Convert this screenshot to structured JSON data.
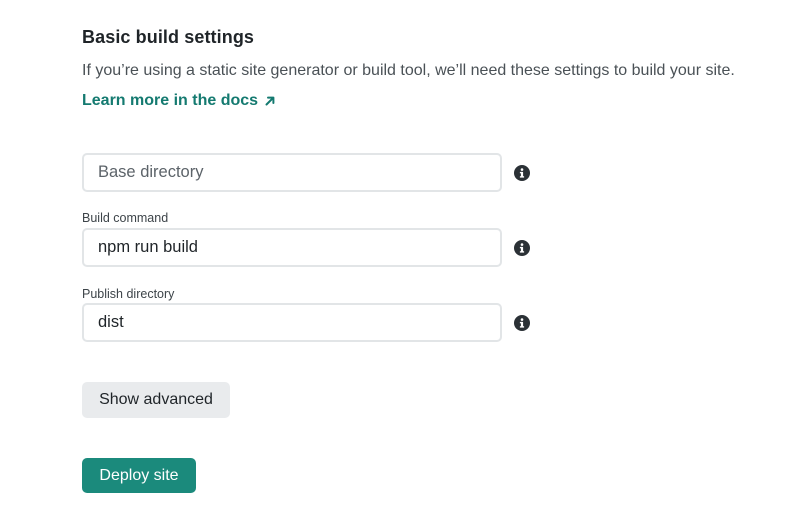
{
  "section": {
    "title": "Basic build settings",
    "description": "If you’re using a static site generator or build tool, we’ll need these settings to build your site.",
    "docs_link": "Learn more in the docs",
    "docs_link_icon": "arrow-up-right-icon"
  },
  "fields": {
    "base_directory": {
      "label": "",
      "placeholder": "Base directory",
      "value": "",
      "help_icon": "info-icon"
    },
    "build_command": {
      "label": "Build command",
      "value": "npm run build",
      "help_icon": "info-icon"
    },
    "publish_directory": {
      "label": "Publish directory",
      "value": "dist",
      "help_icon": "info-icon"
    }
  },
  "buttons": {
    "show_advanced": "Show advanced",
    "deploy": "Deploy site"
  },
  "colors": {
    "accent": "#1b8a7c",
    "link": "#147a70",
    "secondary_button": "#e9ebed",
    "input_border": "#e2e5e7"
  }
}
